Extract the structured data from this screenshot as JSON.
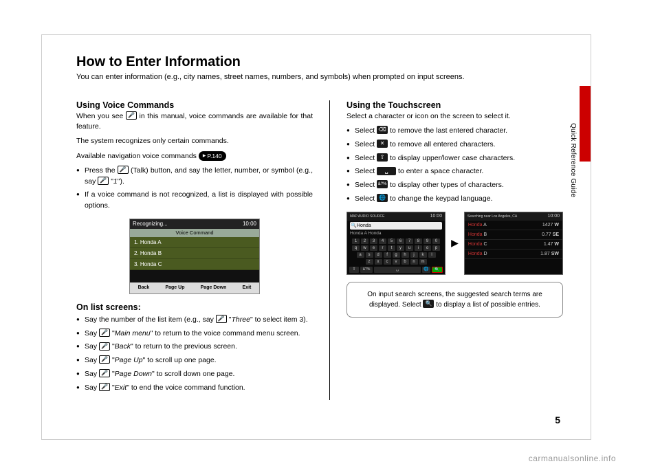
{
  "sideLabel": "Quick Reference Guide",
  "title": "How to Enter Information",
  "subtitle": "You can enter information (e.g., city names, street names, numbers, and symbols) when prompted on input screens.",
  "left": {
    "h1": "Using Voice Commands",
    "p1a": "When you see ",
    "p1b": " in this manual, voice commands are available for that feature.",
    "p2": "The system recognizes only certain commands.",
    "p3": "Available navigation voice commands ",
    "pageRef": "P.140",
    "b1a": "Press the ",
    "b1b": " (Talk) button, and say the letter, number, or symbol (e.g., say ",
    "b1c": " \"",
    "b1cmd": "1",
    "b1d": "\").",
    "b2": "If a voice command is not recognized, a list is displayed with possible options.",
    "shot": {
      "recognizing": "Recognizing...",
      "time": "10:00",
      "vcLabel": "Voice Command",
      "items": [
        "1. Honda A",
        "2. Honda B",
        "3. Honda C"
      ],
      "bot": [
        "Back",
        "Page Up",
        "Page Down",
        "Exit"
      ]
    },
    "h2": "On list screens:",
    "ls1a": "Say the number of the list item (e.g., say ",
    "ls1b": " \"",
    "ls1cmd": "Three",
    "ls1c": "\" to select item 3).",
    "ls2a": "Say ",
    "ls2cmd": "Main menu",
    "ls2b": "\" to return to the voice command menu screen.",
    "ls3cmd": "Back",
    "ls3b": "\" to return to the previous screen.",
    "ls4cmd": "Page Up",
    "ls4b": "\" to scroll up one page.",
    "ls5cmd": "Page Down",
    "ls5b": "\" to scroll down one page.",
    "ls6cmd": "Exit",
    "ls6b": "\" to end the voice command function."
  },
  "right": {
    "h1": "Using the Touchscreen",
    "p1": "Select a character or icon on the screen to select it.",
    "b1": " to remove the last entered character.",
    "b2": " to remove all entered characters.",
    "b3": " to display upper/lower case characters.",
    "b4": " to enter a space character.",
    "b5": " to display other types of characters.",
    "b6": " to change the keypad language.",
    "selectWord": "Select ",
    "kb": {
      "time": "10:00",
      "tabs": "MAP   AUDIO   SOURCE",
      "search": "Honda",
      "sugg": "Honda A    Honda",
      "row1": [
        "1",
        "2",
        "3",
        "4",
        "5",
        "6",
        "7",
        "8",
        "9",
        "0"
      ],
      "row2": [
        "q",
        "w",
        "e",
        "r",
        "t",
        "y",
        "u",
        "i",
        "o",
        "p"
      ],
      "row3": [
        "a",
        "s",
        "d",
        "f",
        "g",
        "h",
        "j",
        "k",
        "l"
      ],
      "row4": [
        "z",
        "x",
        "c",
        "v",
        "b",
        "n",
        "m"
      ]
    },
    "res": {
      "time": "10:00",
      "loc": "Searching near Los Angeles, CA",
      "rows": [
        {
          "name": "Honda",
          "suffix": " A",
          "dist": "1427",
          "dir": "W"
        },
        {
          "name": "Honda",
          "suffix": " B",
          "dist": "0.77",
          "dir": "SE"
        },
        {
          "name": "Honda",
          "suffix": " C",
          "dist": "1.47",
          "dir": "W"
        },
        {
          "name": "Honda",
          "suffix": " D",
          "dist": "1.87",
          "dir": "SW"
        }
      ]
    },
    "infobox1": "On input search screens, the suggested search terms are displayed. Select ",
    "infobox2": " to display a list of possible entries."
  },
  "pageNum": "5",
  "watermark": "carmanualsonline.info"
}
